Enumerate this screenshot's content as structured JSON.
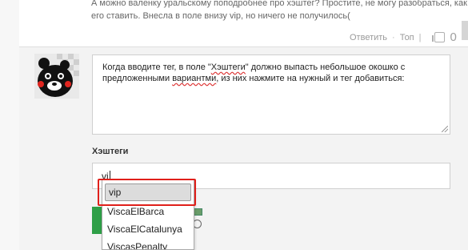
{
  "previous_comment": {
    "text": "А можно валенку уральскому поподробнее про хэштег? Простите, не могу разобраться, как его ставить. Внесла в поле внизу vip, но ничего не получилось(",
    "reply_label": "Ответить",
    "top_label": "Топ",
    "like_count": "0"
  },
  "reply_form": {
    "comment_before": "Когда вводите тег, в поле \"",
    "comment_highlight_1": "Хэштеги",
    "comment_middle": "\" должно выпасть небольшое окошко с предложенными ",
    "comment_highlight_2": "вариантми",
    "comment_after": ", из них нажмите на нужный и тег добавиться:",
    "hashtags_label": "Хэштеги",
    "hashtag_value": "vi"
  },
  "autocomplete": {
    "items": [
      "vip",
      "ViscaElBarca",
      "ViscaElCatalunya",
      "ViscasPenalty"
    ],
    "selected_index": 0
  },
  "colors": {
    "highlight_border": "#e0201b",
    "green_accent": "#2e9f47"
  }
}
